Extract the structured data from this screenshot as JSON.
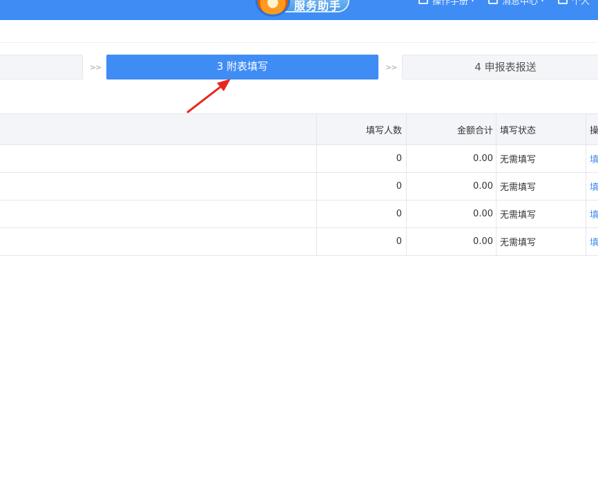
{
  "header": {
    "assistant_label": "服务助手",
    "nav": [
      {
        "label": "操作手册",
        "icon": "manual-icon"
      },
      {
        "label": "消息中心",
        "icon": "message-icon"
      },
      {
        "label": "个人",
        "icon": "user-icon"
      }
    ]
  },
  "steps": {
    "step2_label": "",
    "separator": ">>",
    "step3_label": "3 附表填写",
    "step4_label": "4 申报表报送"
  },
  "table": {
    "columns": [
      "",
      "填写人数",
      "金额合计",
      "填写状态",
      "操"
    ],
    "rows": [
      {
        "name": "",
        "count": "0",
        "amount": "0.00",
        "status": "无需填写",
        "action": "填"
      },
      {
        "name": "",
        "count": "0",
        "amount": "0.00",
        "status": "无需填写",
        "action": "填"
      },
      {
        "name": "",
        "count": "0",
        "amount": "0.00",
        "status": "无需填写",
        "action": "填"
      },
      {
        "name": "",
        "count": "0",
        "amount": "0.00",
        "status": "无需填写",
        "action": "填"
      }
    ]
  },
  "colors": {
    "primary": "#3f8cf5",
    "annotation_arrow": "#e8281e"
  }
}
